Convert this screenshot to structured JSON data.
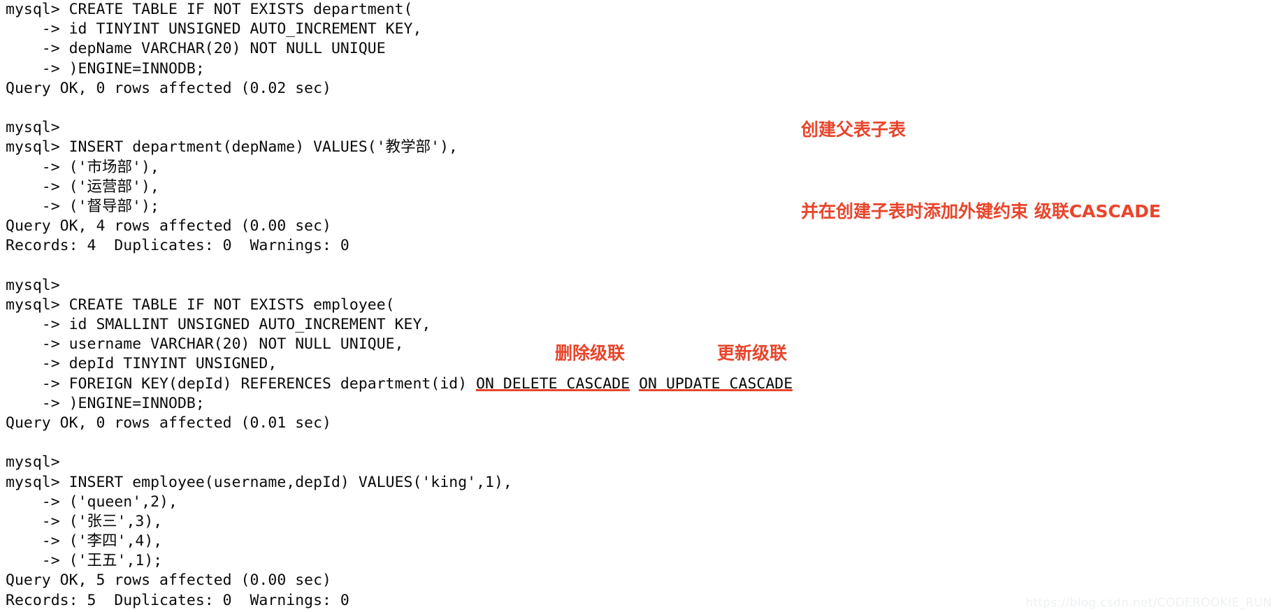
{
  "terminal": {
    "prompt": "mysql>",
    "continuation": "    ->",
    "lines": [
      {
        "id": "l1",
        "text": "mysql> CREATE TABLE IF NOT EXISTS department("
      },
      {
        "id": "l2",
        "text": "    -> id TINYINT UNSIGNED AUTO_INCREMENT KEY,"
      },
      {
        "id": "l3",
        "text": "    -> depName VARCHAR(20) NOT NULL UNIQUE"
      },
      {
        "id": "l4",
        "text": "    -> )ENGINE=INNODB;"
      },
      {
        "id": "l5",
        "text": "Query OK, 0 rows affected (0.02 sec)"
      },
      {
        "id": "l6",
        "text": ""
      },
      {
        "id": "l7",
        "text": "mysql>"
      },
      {
        "id": "l8",
        "text": "mysql> INSERT department(depName) VALUES('教学部'),"
      },
      {
        "id": "l9",
        "text": "    -> ('市场部'),"
      },
      {
        "id": "l10",
        "text": "    -> ('运营部'),"
      },
      {
        "id": "l11",
        "text": "    -> ('督导部');"
      },
      {
        "id": "l12",
        "text": "Query OK, 4 rows affected (0.00 sec)"
      },
      {
        "id": "l13",
        "text": "Records: 4  Duplicates: 0  Warnings: 0"
      },
      {
        "id": "l14",
        "text": ""
      },
      {
        "id": "l15",
        "text": "mysql>"
      },
      {
        "id": "l16",
        "text": "mysql> CREATE TABLE IF NOT EXISTS employee("
      },
      {
        "id": "l17",
        "text": "    -> id SMALLINT UNSIGNED AUTO_INCREMENT KEY,"
      },
      {
        "id": "l18",
        "text": "    -> username VARCHAR(20) NOT NULL UNIQUE,"
      },
      {
        "id": "l19",
        "text": "    -> depId TINYINT UNSIGNED,"
      },
      {
        "id": "l20",
        "text": "",
        "parts": [
          {
            "text": "    -> FOREIGN KEY(depId) REFERENCES department(id) ",
            "underline": false
          },
          {
            "text": "ON DELETE CASCADE",
            "underline": true
          },
          {
            "text": " ",
            "underline": false
          },
          {
            "text": "ON UPDATE CASCADE",
            "underline": true
          }
        ]
      },
      {
        "id": "l21",
        "text": "    -> )ENGINE=INNODB;"
      },
      {
        "id": "l22",
        "text": "Query OK, 0 rows affected (0.01 sec)"
      },
      {
        "id": "l23",
        "text": ""
      },
      {
        "id": "l24",
        "text": "mysql>"
      },
      {
        "id": "l25",
        "text": "mysql> INSERT employee(username,depId) VALUES('king',1),"
      },
      {
        "id": "l26",
        "text": "    -> ('queen',2),"
      },
      {
        "id": "l27",
        "text": "    -> ('张三',3),"
      },
      {
        "id": "l28",
        "text": "    -> ('李四',4),"
      },
      {
        "id": "l29",
        "text": "    -> ('王五',1);"
      },
      {
        "id": "l30",
        "text": "Query OK, 5 rows affected (0.00 sec)"
      },
      {
        "id": "l31",
        "text": "Records: 5  Duplicates: 0  Warnings: 0"
      }
    ]
  },
  "annotations": {
    "color": "#e8452c",
    "create_tables": {
      "line1": "创建父表子表",
      "line2": "并在创建子表时添加外键约束 级联CASCADE"
    },
    "delete_cascade": "删除级联",
    "update_cascade": "更新级联"
  },
  "watermark": {
    "text": "https://blog.csdn.net/CODEROOKIE_RUN",
    "color": "#eef1f3"
  }
}
